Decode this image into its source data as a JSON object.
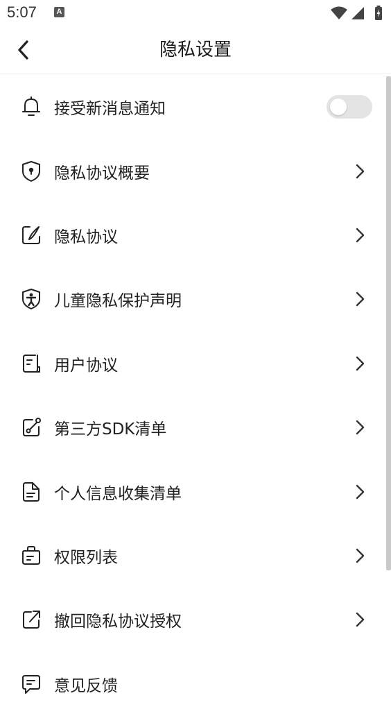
{
  "status_bar": {
    "time": "5:07",
    "notification_icon": "A"
  },
  "header": {
    "title": "隐私设置",
    "back_icon": "chevron-left-icon"
  },
  "settings": [
    {
      "label": "接受新消息通知",
      "icon": "bell-icon",
      "control": "toggle",
      "toggle_on": false
    },
    {
      "label": "隐私协议概要",
      "icon": "shield-keyhole-icon",
      "control": "chevron"
    },
    {
      "label": "隐私协议",
      "icon": "edit-note-icon",
      "control": "chevron"
    },
    {
      "label": "儿童隐私保护声明",
      "icon": "child-shield-icon",
      "control": "chevron"
    },
    {
      "label": "用户协议",
      "icon": "document-icon",
      "control": "chevron"
    },
    {
      "label": "第三方SDK清单",
      "icon": "share-link-icon",
      "control": "chevron"
    },
    {
      "label": "个人信息收集清单",
      "icon": "file-list-icon",
      "control": "chevron"
    },
    {
      "label": "权限列表",
      "icon": "briefcase-icon",
      "control": "chevron"
    },
    {
      "label": "撤回隐私协议授权",
      "icon": "external-revoke-icon",
      "control": "chevron"
    },
    {
      "label": "意见反馈",
      "icon": "feedback-message-icon",
      "control": "none"
    }
  ],
  "colors": {
    "toggle_off": "#e4e4e4",
    "text": "#222222",
    "divider": "#eeeeee"
  }
}
